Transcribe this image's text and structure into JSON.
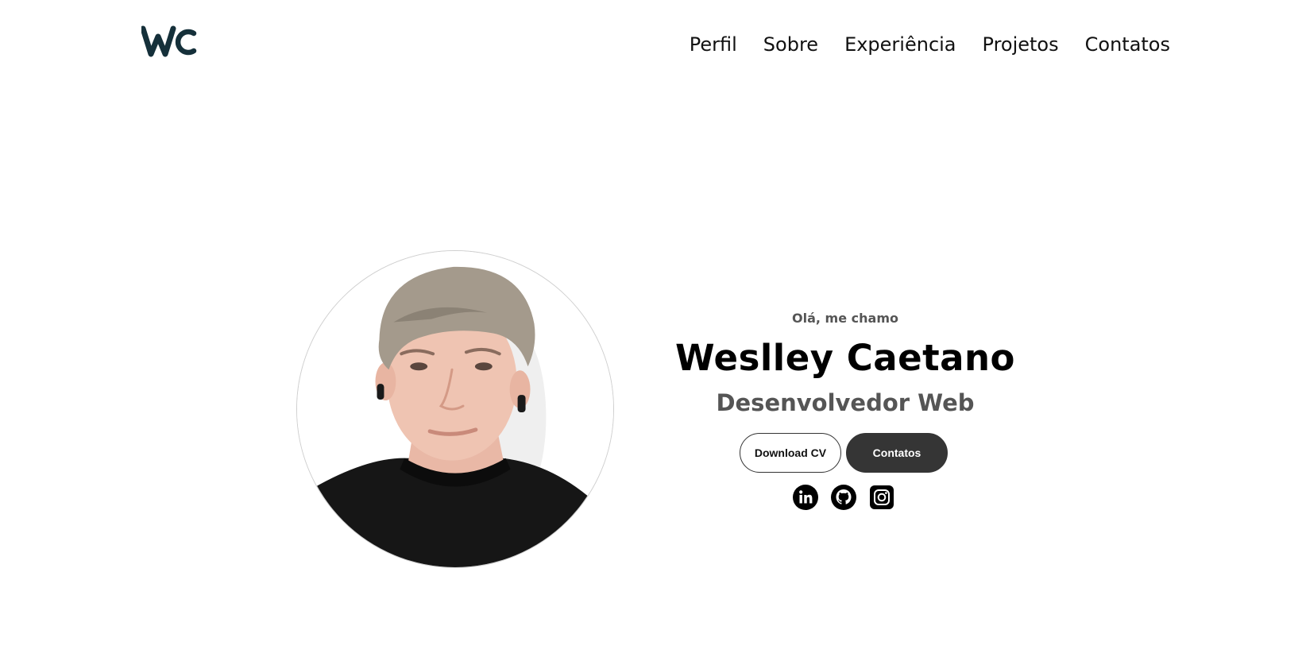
{
  "header": {
    "logo_text": "WC",
    "nav": [
      {
        "label": "Perfil"
      },
      {
        "label": "Sobre"
      },
      {
        "label": "Experiência"
      },
      {
        "label": "Projetos"
      },
      {
        "label": "Contatos"
      }
    ]
  },
  "hero": {
    "greeting": "Olá, me chamo",
    "name": "Weslley Caetano",
    "role": "Desenvolvedor Web",
    "buttons": {
      "download_cv": "Download CV",
      "contacts": "Contatos"
    },
    "socials": [
      {
        "icon": "linkedin-icon"
      },
      {
        "icon": "github-icon"
      },
      {
        "icon": "instagram-icon"
      }
    ]
  },
  "colors": {
    "logo": "#15303a",
    "text_dark": "#000000",
    "text_muted": "#555555",
    "button_dark": "#353535",
    "background": "#ffffff"
  }
}
